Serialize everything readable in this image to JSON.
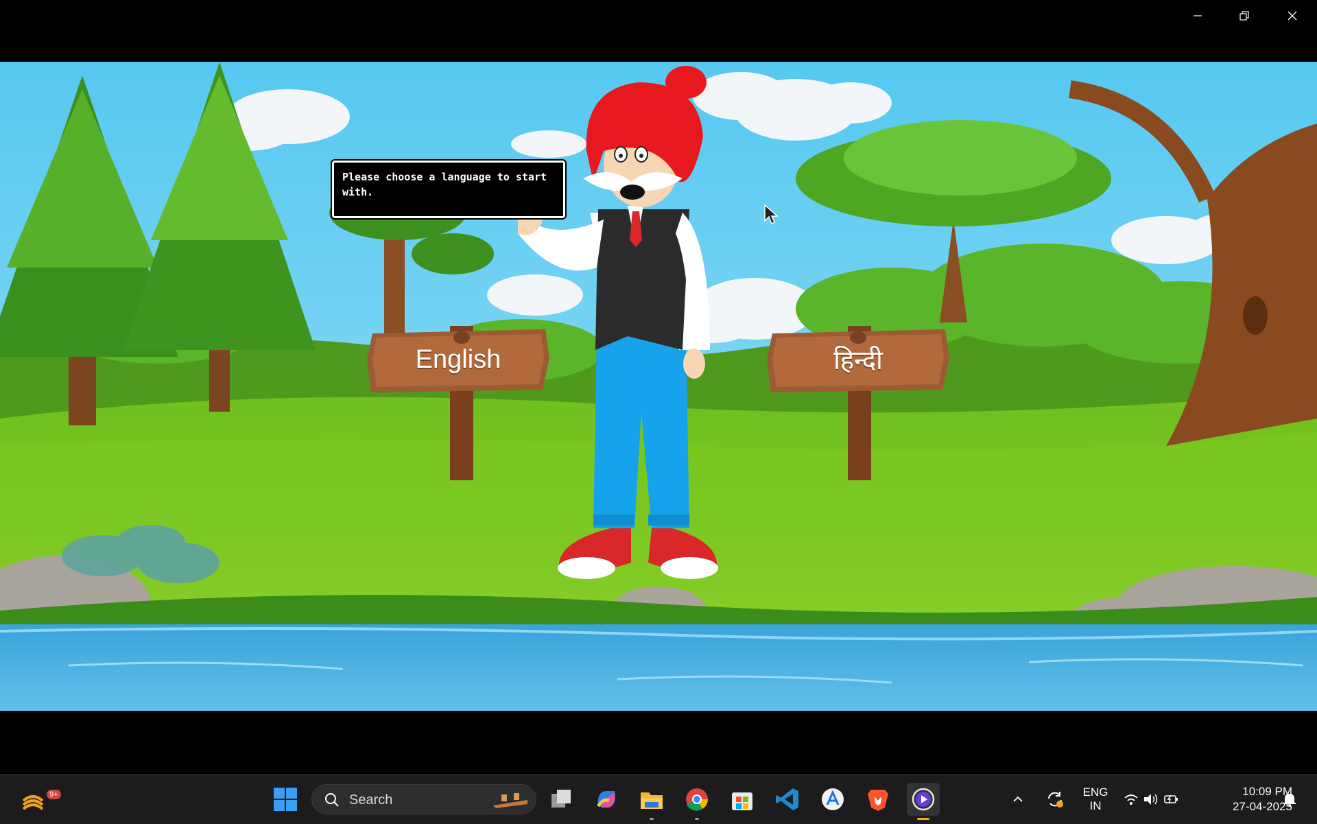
{
  "window": {
    "minimize_icon": "minimize-icon",
    "restore_icon": "restore-icon",
    "close_icon": "close-icon"
  },
  "game": {
    "speech_text": "Please choose a language to start with.",
    "sign_left_label": "English",
    "sign_right_label": "हिन्दी"
  },
  "taskbar": {
    "weather_badge": "9+",
    "search_label": "Search",
    "apps": [
      "start-icon",
      "task-view-icon",
      "copilot-icon",
      "file-explorer-icon",
      "chrome-icon",
      "microsoft-store-icon",
      "vscode-icon",
      "app-icon",
      "brave-icon",
      "media-player-icon"
    ],
    "language_top": "ENG",
    "language_bottom": "IN",
    "time": "10:09 PM",
    "date": "27-04-2025"
  }
}
